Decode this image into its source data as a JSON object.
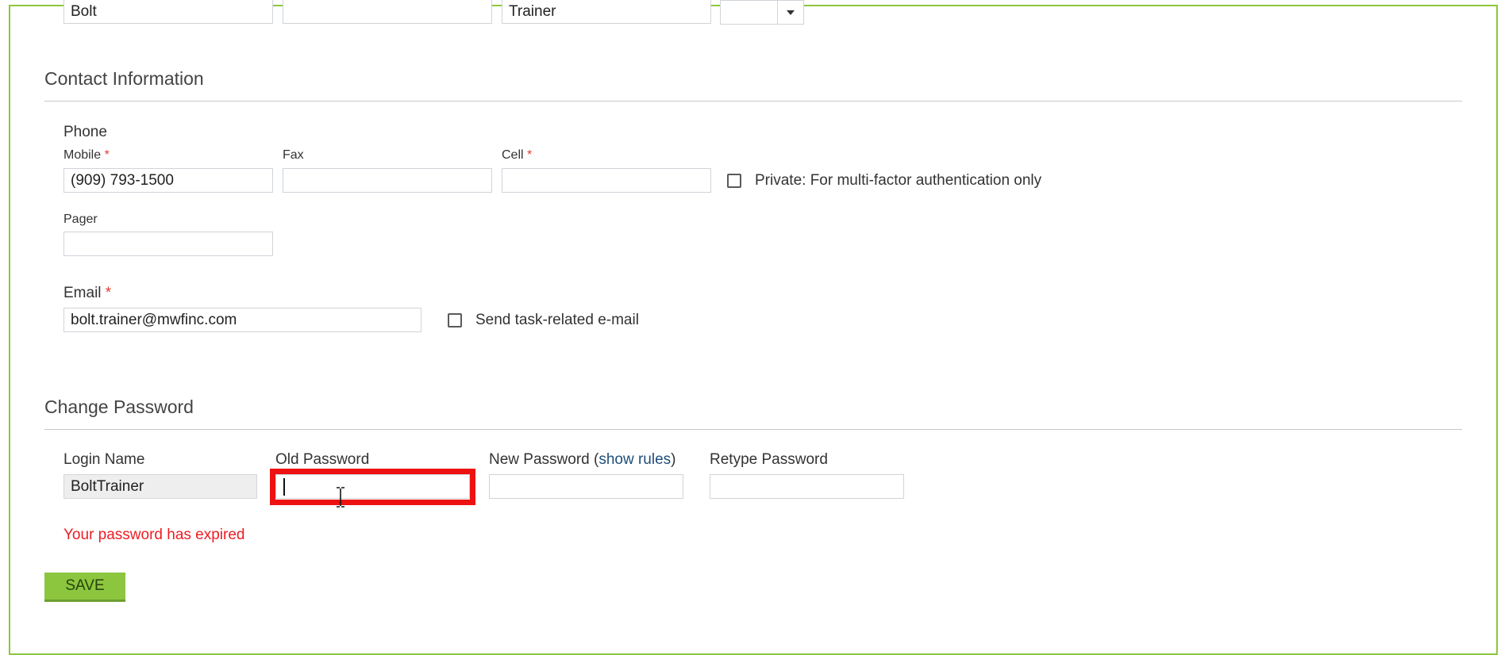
{
  "name_row": {
    "first_name_value": "Bolt",
    "middle_name_value": "",
    "last_name_value": "Trainer",
    "suffix_value": ""
  },
  "contact": {
    "section_title": "Contact Information",
    "phone_heading": "Phone",
    "mobile_label": "Mobile",
    "mobile_value": "(909) 793-1500",
    "fax_label": "Fax",
    "fax_value": "",
    "cell_label": "Cell",
    "cell_value": "",
    "private_label": "Private: For multi-factor authentication only",
    "pager_label": "Pager",
    "pager_value": "",
    "email_label": "Email",
    "email_value": "bolt.trainer@mwfinc.com",
    "send_task_email_label": "Send task-related e-mail",
    "required_marker": "*"
  },
  "password": {
    "section_title": "Change Password",
    "login_name_label": "Login Name",
    "login_name_value": "BoltTrainer",
    "old_password_label": "Old Password",
    "old_password_value": "",
    "new_password_label": "New Password",
    "show_rules_open": "(",
    "show_rules_link": "show rules",
    "show_rules_close": ")",
    "retype_password_label": "Retype Password",
    "retype_password_value": "",
    "new_password_value": "",
    "error_message": "Your password has expired"
  },
  "actions": {
    "save_label": "SAVE"
  },
  "colors": {
    "frame_border": "#8dc63f",
    "save_button": "#8cc63f",
    "error_text": "#ee1c24",
    "required_marker": "#e03c31",
    "highlight": "#ee1111",
    "link": "#1f4e79"
  },
  "icons": {
    "dropdown": "chevron-down-icon",
    "text_cursor": "ibeam-cursor-icon"
  }
}
